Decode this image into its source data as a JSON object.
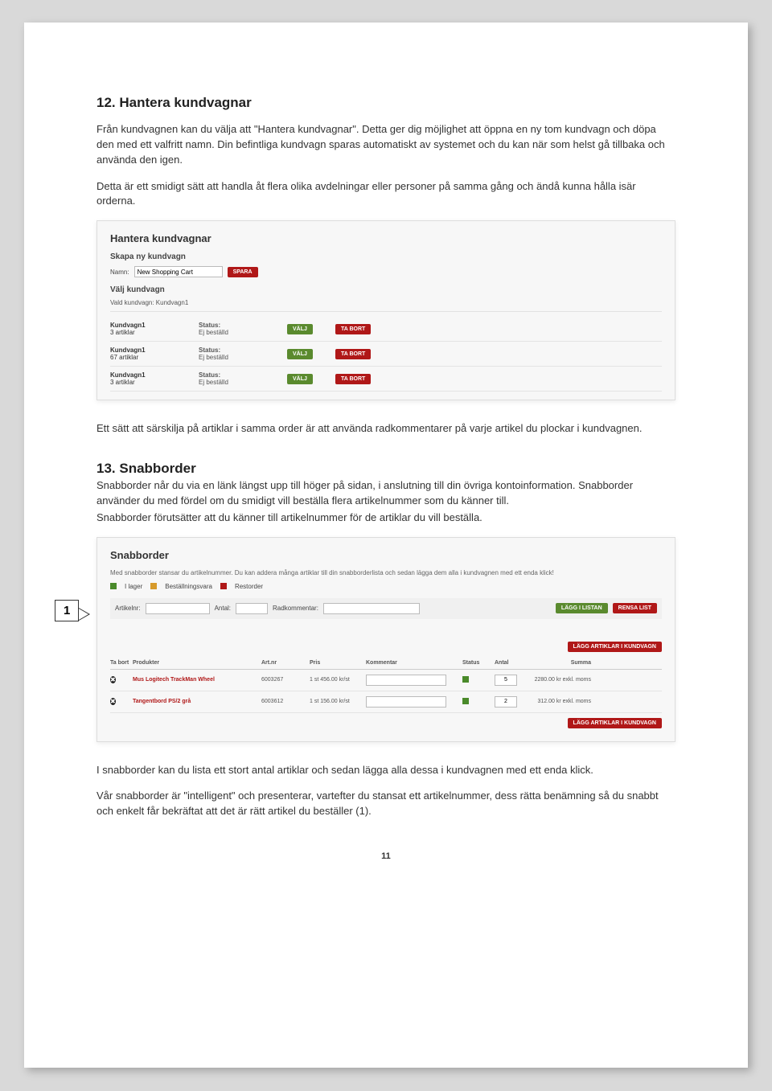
{
  "section12": {
    "heading": "12. Hantera kundvagnar",
    "p1": "Från kundvagnen kan du välja att \"Hantera kundvagnar\". Detta ger dig möjlighet att öppna en ny tom kundvagn och döpa den med ett valfritt namn. Din befintliga kundvagn sparas automatiskt av systemet och du kan när som helst gå tillbaka och använda den igen.",
    "p2": "Detta är ett smidigt sätt att handla åt flera olika avdelningar eller personer på samma gång och ändå kunna hålla isär orderna.",
    "p3": "Ett sätt att särskilja på artiklar i samma order är att använda radkommentarer på varje artikel du plockar i kundvagnen."
  },
  "cartShot": {
    "title": "Hantera kundvagnar",
    "createHeading": "Skapa ny kundvagn",
    "nameLabel": "Namn:",
    "nameValue": "New Shopping Cart",
    "saveBtn": "SPARA",
    "chooseHeading": "Välj kundvagn",
    "selectedLine": "Vald kundvagn: Kundvagn1",
    "valjBtn": "VÄLJ",
    "taBortBtn": "TA BORT",
    "rows": [
      {
        "name": "Kundvagn1",
        "sub": "3 artiklar",
        "statusLabel": "Status:",
        "statusVal": "Ej beställd"
      },
      {
        "name": "Kundvagn1",
        "sub": "67 artiklar",
        "statusLabel": "Status:",
        "statusVal": "Ej beställd"
      },
      {
        "name": "Kundvagn1",
        "sub": "3 artiklar",
        "statusLabel": "Status:",
        "statusVal": "Ej beställd"
      }
    ]
  },
  "section13": {
    "heading": "13. Snabborder",
    "p1": "Snabborder når du via en länk längst upp till höger på sidan, i anslutning till din övriga kontoinformation. Snabborder använder du med fördel om du smidigt vill beställa flera artikelnummer som du känner till.",
    "p2": "Snabborder förutsätter att du känner till artikelnummer för de artiklar du vill beställa.",
    "p3": "I snabborder kan du lista ett stort antal artiklar och sedan lägga alla dessa i kundvagnen med ett enda klick.",
    "p4": "Vår snabborder är \"intelligent\" och presenterar, vartefter du stansat ett artikelnummer, dess rätta benämning så du snabbt och enkelt får bekräftat att det är rätt artikel du beställer (1)."
  },
  "snabShot": {
    "title": "Snabborder",
    "desc": "Med snabborder stansar du artikelnummer. Du kan addera många artiklar till din snabborderlista och sedan lägga dem alla i kundvagnen med ett enda klick!",
    "legend": {
      "inStock": "I lager",
      "orderItem": "Beställningsvara",
      "backorder": "Restorder"
    },
    "form": {
      "artLabel": "Artikelnr:",
      "qtyLabel": "Antal:",
      "commentLabel": "Radkommentar:",
      "addBtn": "LÄGG I LISTAN",
      "clearBtn": "RENSA LIST"
    },
    "bigBtn": "LÄGG ARTIKLAR I KUNDVAGN",
    "head": {
      "del": "Ta bort",
      "prod": "Produkter",
      "art": "Art.nr",
      "price": "Pris",
      "comment": "Kommentar",
      "status": "Status",
      "qty": "Antal",
      "sum": "Summa"
    },
    "rows": [
      {
        "prod": "Mus Logitech TrackMan Wheel",
        "art": "6003267",
        "price": "1 st 456.00 kr/st",
        "qty": "5",
        "sum": "2280.00 kr exkl. moms"
      },
      {
        "prod": "Tangentbord PS/2 grå",
        "art": "6003612",
        "price": "1 st 156.00 kr/st",
        "qty": "2",
        "sum": "312.00 kr exkl. moms"
      }
    ]
  },
  "callouts": {
    "one": "1"
  },
  "pageNumber": "11"
}
